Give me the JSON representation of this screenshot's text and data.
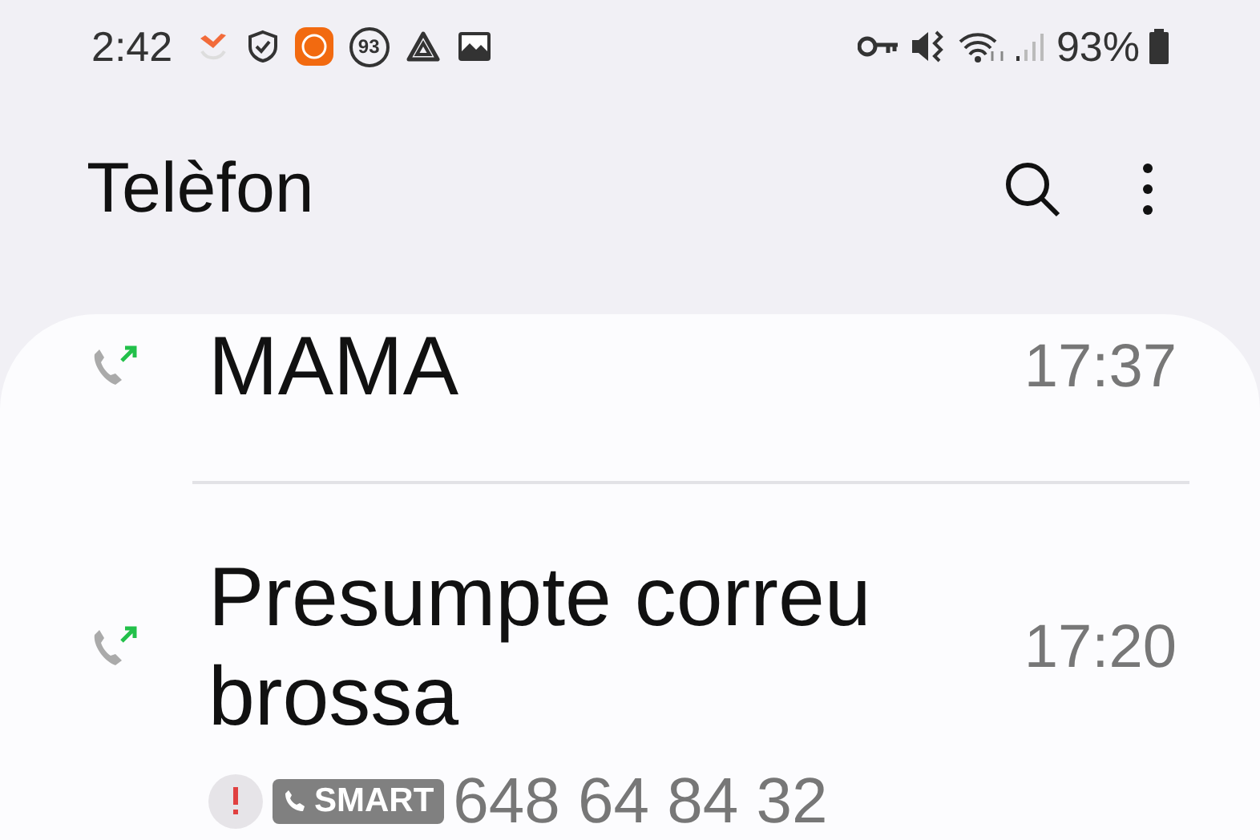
{
  "status_bar": {
    "time": "2:42",
    "notification_badge": "93",
    "battery": "93%"
  },
  "header": {
    "title": "Telèfon"
  },
  "calls": [
    {
      "name": "MAMA",
      "time": "17:37",
      "kind": "outgoing",
      "spam": false
    },
    {
      "name": "Presumpte correu brossa",
      "time": "17:20",
      "kind": "outgoing",
      "spam": true,
      "badge": "SMART",
      "number": "648 64 84 32"
    }
  ]
}
